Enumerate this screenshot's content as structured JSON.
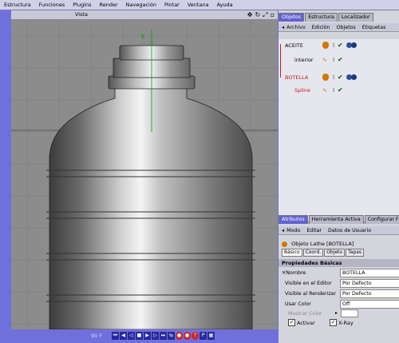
{
  "menu": [
    "Estructura",
    "Funciones",
    "Plugins",
    "Render",
    "Navegación",
    "Pintar",
    "Ventana",
    "Ayuda"
  ],
  "viewport": {
    "title": "Vista",
    "frame": "90 F",
    "axis_y": "Y"
  },
  "object_manager": {
    "tabs": [
      "Objetos",
      "Estructura",
      "Localizador"
    ],
    "toolbar": [
      "Archivo",
      "Edición",
      "Objetos",
      "Etiquetas"
    ],
    "items": [
      {
        "name": "ACEITE",
        "color": "#000000"
      },
      {
        "name": "interior",
        "color": "#000000"
      },
      {
        "name": "BOTELLA",
        "color": "#c02020"
      },
      {
        "name": "Spline",
        "color": "#c02020"
      }
    ]
  },
  "attributes": {
    "tabs": [
      "Atributos",
      "Herramienta Activa",
      "Configurar F"
    ],
    "toolbar": [
      "Modo",
      "Editar",
      "Datos de Usuario"
    ],
    "object_title": "Objeto Lathe [BOTELLA]",
    "subtabs": [
      "Básico",
      "Coord.",
      "Objeto",
      "Tapas"
    ],
    "section": "Propiedades Básicas",
    "fields": [
      {
        "label": "Nombre",
        "value": "BOTELLA"
      },
      {
        "label": "Visible en el Editor",
        "value": "Por Defecto"
      },
      {
        "label": "Visible al Renderizar",
        "value": "Por Defecto"
      },
      {
        "label": "Usar Color",
        "value": "Off"
      },
      {
        "label": "Mostrar Color",
        "value": ""
      }
    ],
    "checks": [
      {
        "label": "Activar",
        "checked": true
      },
      {
        "label": "X-Ray",
        "checked": true
      }
    ]
  }
}
